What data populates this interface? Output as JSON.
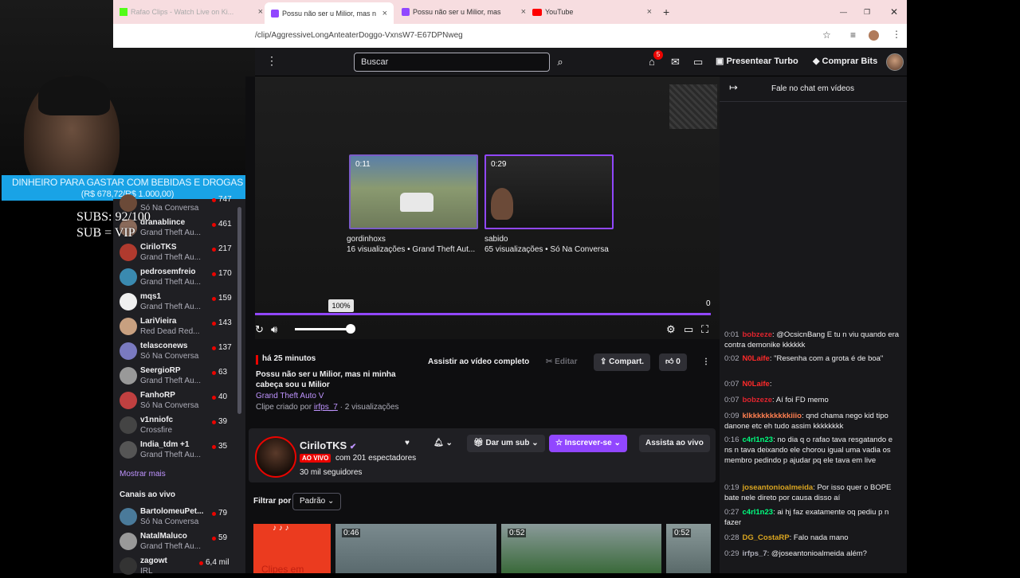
{
  "browser": {
    "tabs": [
      {
        "label": "Rafao Clips - Watch Live on Ki..."
      },
      {
        "label": "Possu não ser u Milior, mas n",
        "active": true
      },
      {
        "label": "Possu não ser u Milior, mas n"
      },
      {
        "label": "YouTube"
      }
    ],
    "url": "/clip/AggressiveLongAnteaterDoggo-VxnsW7-E67DPNweg"
  },
  "overlay": {
    "donation_title": "DINHEIRO PARA GASTAR COM BEBIDAS E DROGAS",
    "donation_amount": "(R$ 678,72/R$ 1.000,00)",
    "subs_line": "SUBS: 92/100",
    "sub_vip_line": "SUB = VIP"
  },
  "topbar": {
    "search_placeholder": "Buscar",
    "notifications_count": "5",
    "turbo_label": "Presentear Turbo",
    "bits_label": "Comprar Bits"
  },
  "sidebar": {
    "items": [
      {
        "name": "",
        "game": "Só Na Conversa",
        "count": "747"
      },
      {
        "name": "dranablince",
        "game": "Grand Theft Au...",
        "count": "461"
      },
      {
        "name": "CiriloTKS",
        "game": "Grand Theft Au...",
        "count": "217"
      },
      {
        "name": "pedrosemfreio",
        "game": "Grand Theft Au...",
        "count": "170"
      },
      {
        "name": "mqs1",
        "game": "Grand Theft Au...",
        "count": "159"
      },
      {
        "name": "LariVieira",
        "game": "Red Dead Red...",
        "count": "143"
      },
      {
        "name": "telasconews",
        "game": "Só Na Conversa",
        "count": "137"
      },
      {
        "name": "SeergioRP",
        "game": "Grand Theft Au...",
        "count": "63"
      },
      {
        "name": "FanhoRP",
        "game": "Só Na Conversa",
        "count": "40"
      },
      {
        "name": "v1nniofc",
        "game": "Crossfire",
        "count": "39"
      },
      {
        "name": "India_tdm +1",
        "game": "Grand Theft Au...",
        "count": "35"
      }
    ],
    "show_more": "Mostrar mais",
    "live_channels_header": "Canais ao vivo",
    "live_items": [
      {
        "name": "BartolomeuPet...",
        "game": "Só Na Conversa",
        "count": "79"
      },
      {
        "name": "NatalMaluco",
        "game": "Grand Theft Au...",
        "count": "59"
      },
      {
        "name": "zagowt",
        "game": "IRL",
        "count": "6,4 mil"
      }
    ]
  },
  "player": {
    "recs": [
      {
        "time": "0:11",
        "user": "gordinhoxs",
        "meta": "16 visualizações • Grand Theft Aut..."
      },
      {
        "time": "0:29",
        "user": "sabido",
        "meta": "65 visualizações • Só Na Conversa"
      }
    ],
    "volume_tooltip": "100%",
    "elapsed": "0"
  },
  "clip": {
    "ago": "há 25 minutos",
    "title": "Possu não ser u Milior, mas ni minha cabeça sou u Milior",
    "game": "Grand Theft Auto V",
    "by_prefix": "Clipe criado por",
    "by_user": "irfps_7",
    "views": "· 2 visualizações",
    "watch_full": "Assistir ao vídeo completo",
    "edit": "Editar",
    "share": "Compart.",
    "likes": "0"
  },
  "channel": {
    "name": "CiriloTKS",
    "live_badge": "AO VIVO",
    "viewers": "com 201 espectadores",
    "followers": "30 mil seguidores",
    "gift_sub": "Dar um sub",
    "subscribe": "Inscrever-se",
    "watch_live": "Assista ao vivo"
  },
  "filter": {
    "label": "Filtrar por",
    "selected": "Padrão"
  },
  "thumbs": [
    {
      "time": ""
    },
    {
      "time": "0:46"
    },
    {
      "time": "0:52"
    },
    {
      "time": "0:52"
    }
  ],
  "thumb_first_caption": "Clipes em",
  "chat": {
    "title": "Fale no chat em vídeos",
    "messages": [
      {
        "ts": "0:01",
        "user": "bobzeze",
        "color": "#e0242e",
        "text": ": @OcsicnBang E tu n viu quando era contra demonike kkkkkk"
      },
      {
        "ts": "0:02",
        "user": "N0Laife",
        "color": "#ff2a2a",
        "text": ": \"Resenha com a grota é de boa\""
      },
      {
        "ts": "0:07",
        "user": "N0Laife",
        "color": "#ff2a2a",
        "text": ":"
      },
      {
        "ts": "0:07",
        "user": "bobzeze",
        "color": "#e0242e",
        "text": ": Aí foi FD memo"
      },
      {
        "ts": "0:09",
        "user": "klkkkkkkkkkkiiio",
        "color": "#ff7f50",
        "text": ": qnd chama nego kid tipo danone etc eh tudo assim kkkkkkkk"
      },
      {
        "ts": "0:16",
        "user": "c4rl1n23",
        "color": "#00ff7f",
        "text": ": no dia q o rafao tava resgatando e ns n tava deixando ele chorou igual uma vadia os membro pedindo p ajudar pq ele tava em live"
      },
      {
        "ts": "0:19",
        "user": "joseantonioalmeida",
        "color": "#daa520",
        "text": ": Por isso quer o BOPE bate nele direto por causa disso aí"
      },
      {
        "ts": "0:27",
        "user": "c4rl1n23",
        "color": "#00ff7f",
        "text": ": ai hj faz exatamente oq pediu p n fazer"
      },
      {
        "ts": "0:28",
        "user": "DG_CostaRP",
        "color": "#daa520",
        "text": ": Falo nada mano"
      },
      {
        "ts": "0:29",
        "user": "irfps_7",
        "color": "#adadb8",
        "text": ": @joseantonioalmeida além?"
      }
    ]
  }
}
